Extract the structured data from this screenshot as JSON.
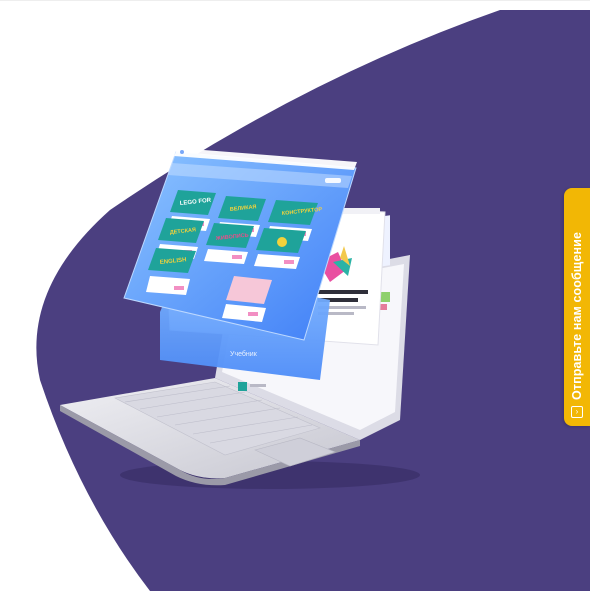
{
  "colors": {
    "background": "#ffffff",
    "hero_shape": "#4b3f80",
    "chat_tab": "#f2b705",
    "screen_gradient_start": "#74b8ff",
    "screen_gradient_end": "#3f7ef7",
    "card_green": "#1fa39a",
    "card_button_pink": "#f28fc3"
  },
  "hero": {
    "illustration": "laptop-with-floating-app-screens",
    "floating_screen": {
      "banner_cards": 8,
      "footer_caption": "Учебник"
    }
  },
  "chat_widget": {
    "label": "Отправьте нам сообщение",
    "icon": "message-icon"
  }
}
